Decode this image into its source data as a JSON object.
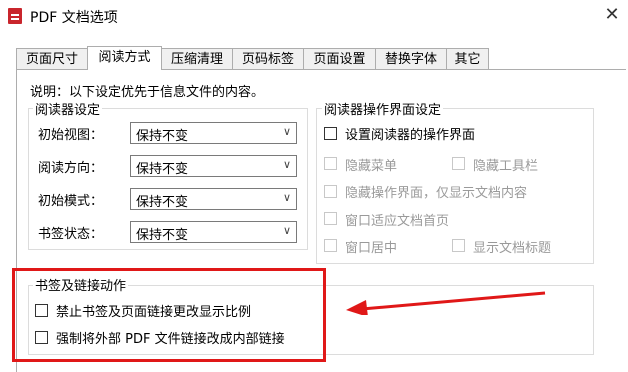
{
  "window": {
    "title": "PDF 文档选项",
    "close_glyph": "✕"
  },
  "tabs": [
    {
      "label": "页面尺寸"
    },
    {
      "label": "阅读方式",
      "active": true
    },
    {
      "label": "压缩清理"
    },
    {
      "label": "页码标签"
    },
    {
      "label": "页面设置"
    },
    {
      "label": "替换字体"
    },
    {
      "label": "其它"
    }
  ],
  "description": "说明：以下设定优先于信息文件的内容。",
  "reader_settings": {
    "title": "阅读器设定",
    "rows": [
      {
        "label": "初始视图：",
        "value": "保持不变"
      },
      {
        "label": "阅读方向：",
        "value": "保持不变"
      },
      {
        "label": "初始模式：",
        "value": "保持不变"
      },
      {
        "label": "书签状态：",
        "value": "保持不变"
      }
    ]
  },
  "reader_ui": {
    "title": "阅读器操作界面设定",
    "main_checkbox": "设置阅读器的操作界面",
    "options": {
      "hide_menu": "隐藏菜单",
      "hide_toolbar": "隐藏工具栏",
      "hide_ui": "隐藏操作界面，仅显示文档内容",
      "fit_window": "窗口适应文档首页",
      "center_window": "窗口居中",
      "show_title": "显示文档标题"
    }
  },
  "bookmark_links": {
    "title": "书签及链接动作",
    "items": [
      {
        "label": "禁止书签及页面链接更改显示比例"
      },
      {
        "label": "强制将外部 PDF 文件链接改成内部链接"
      }
    ]
  },
  "annotation_color": "#e01818"
}
